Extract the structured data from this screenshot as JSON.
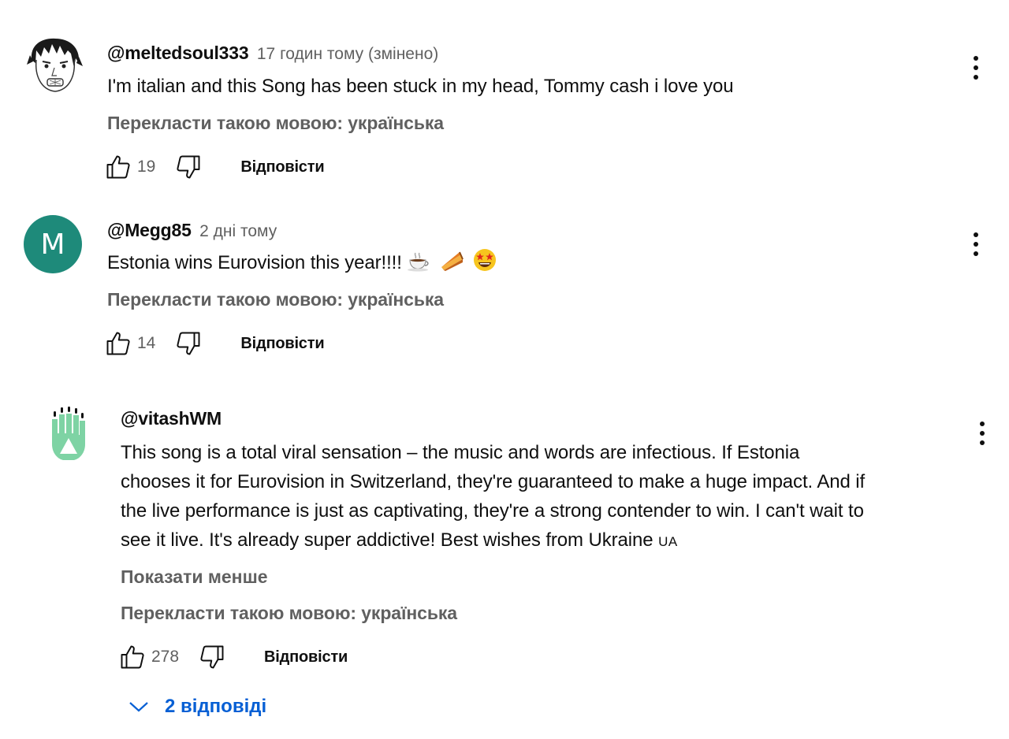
{
  "comments": [
    {
      "author": "@meltedsoul333",
      "time": "17 годин тому (змінено)",
      "text": "I'm italian and this Song has been stuck in my head, Tommy cash i love you",
      "translate": "Перекласти такою мовою: українська",
      "likes": "19",
      "reply_label": "Відповісти",
      "avatar_icon": "drawn-face-avatar"
    },
    {
      "author": "@Megg85",
      "time": "2 дні тому",
      "text": "Estonia wins Eurovision this year!!!!",
      "emojis": [
        "coffee",
        "pie-slice",
        "star-struck-face"
      ],
      "translate": "Перекласти такою мовою: українська",
      "likes": "14",
      "reply_label": "Відповісти",
      "avatar_letter": "M",
      "avatar_color": "#1e8a7a"
    },
    {
      "author": "@vitashWM",
      "time": "",
      "text_lines": [
        "This song is a total viral sensation – the music and words are infectious. If Estonia",
        "chooses it for Eurovision in Switzerland, they're guaranteed to make a huge impact. And if",
        "the live performance is just as captivating, they're a strong contender to win. I can't wait to",
        "see it live. It's already super addictive! Best wishes from Ukraine"
      ],
      "flag_text": "UA",
      "show_less": "Показати менше",
      "translate": "Перекласти такою мовою: українська",
      "likes": "278",
      "reply_label": "Відповісти",
      "replies_label": "2 відповіді",
      "avatar_icon": "green-hand-avatar",
      "avatar_color": "#7ed3a4"
    }
  ],
  "colors": {
    "secondary_text": "#606060",
    "link_blue": "#065fd4"
  }
}
